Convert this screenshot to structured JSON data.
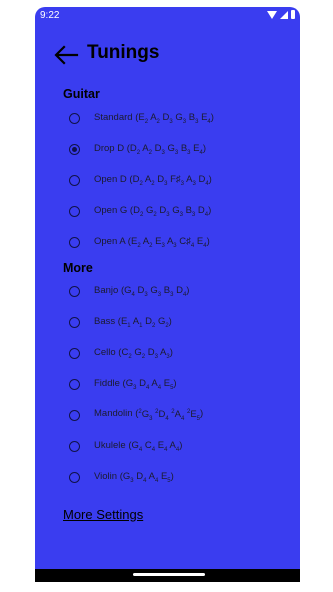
{
  "status": {
    "time": "9:22"
  },
  "header": {
    "title": "Tunings",
    "back_icon": "arrow-left-icon"
  },
  "sections": [
    {
      "label": "Guitar"
    },
    {
      "label": "More"
    }
  ],
  "tunings": [
    {
      "name": "Standard",
      "notes": [
        [
          "E",
          "2"
        ],
        [
          "A",
          "2"
        ],
        [
          "D",
          "3"
        ],
        [
          "G",
          "3"
        ],
        [
          "B",
          "3"
        ],
        [
          "E",
          "4"
        ]
      ],
      "selected": false
    },
    {
      "name": "Drop D",
      "notes": [
        [
          "D",
          "2"
        ],
        [
          "A",
          "2"
        ],
        [
          "D",
          "3"
        ],
        [
          "G",
          "3"
        ],
        [
          "B",
          "3"
        ],
        [
          "E",
          "4"
        ]
      ],
      "selected": true
    },
    {
      "name": "Open D",
      "notes": [
        [
          "D",
          "2"
        ],
        [
          "A",
          "2"
        ],
        [
          "D",
          "3"
        ],
        [
          "F♯",
          "3"
        ],
        [
          "A",
          "3"
        ],
        [
          "D",
          "4"
        ]
      ],
      "selected": false
    },
    {
      "name": "Open G",
      "notes": [
        [
          "D",
          "2"
        ],
        [
          "G",
          "2"
        ],
        [
          "D",
          "3"
        ],
        [
          "G",
          "3"
        ],
        [
          "B",
          "3"
        ],
        [
          "D",
          "4"
        ]
      ],
      "selected": false
    },
    {
      "name": "Open A",
      "notes": [
        [
          "E",
          "2"
        ],
        [
          "A",
          "2"
        ],
        [
          "E",
          "3"
        ],
        [
          "A",
          "3"
        ],
        [
          "C♯",
          "4"
        ],
        [
          "E",
          "4"
        ]
      ],
      "selected": false
    },
    {
      "name": "Banjo",
      "notes": [
        [
          "G",
          "4"
        ],
        [
          "D",
          "3"
        ],
        [
          "G",
          "3"
        ],
        [
          "B",
          "3"
        ],
        [
          "D",
          "4"
        ]
      ],
      "selected": false
    },
    {
      "name": "Bass",
      "notes": [
        [
          "E",
          "1"
        ],
        [
          "A",
          "1"
        ],
        [
          "D",
          "2"
        ],
        [
          "G",
          "2"
        ]
      ],
      "selected": false
    },
    {
      "name": "Cello",
      "notes": [
        [
          "C",
          "2"
        ],
        [
          "G",
          "2"
        ],
        [
          "D",
          "3"
        ],
        [
          "A",
          "3"
        ]
      ],
      "selected": false
    },
    {
      "name": "Fiddle",
      "notes": [
        [
          "G",
          "3"
        ],
        [
          "D",
          "4"
        ],
        [
          "A",
          "4"
        ],
        [
          "E",
          "5"
        ]
      ],
      "selected": false
    },
    {
      "name": "Mandolin",
      "notes": [
        [
          "2",
          "G",
          "3"
        ],
        [
          "2",
          "D",
          "4"
        ],
        [
          "2",
          "A",
          "4"
        ],
        [
          "2",
          "E",
          "5"
        ]
      ],
      "selected": false
    },
    {
      "name": "Ukulele",
      "notes": [
        [
          "G",
          "4"
        ],
        [
          "C",
          "4"
        ],
        [
          "E",
          "4"
        ],
        [
          "A",
          "4"
        ]
      ],
      "selected": false
    },
    {
      "name": "Violin",
      "notes": [
        [
          "G",
          "3"
        ],
        [
          "D",
          "4"
        ],
        [
          "A",
          "4"
        ],
        [
          "E",
          "5"
        ]
      ],
      "selected": false
    }
  ],
  "footer": {
    "more_settings": "More Settings"
  },
  "colors": {
    "background": "#3a3df0",
    "text": "#000000"
  }
}
